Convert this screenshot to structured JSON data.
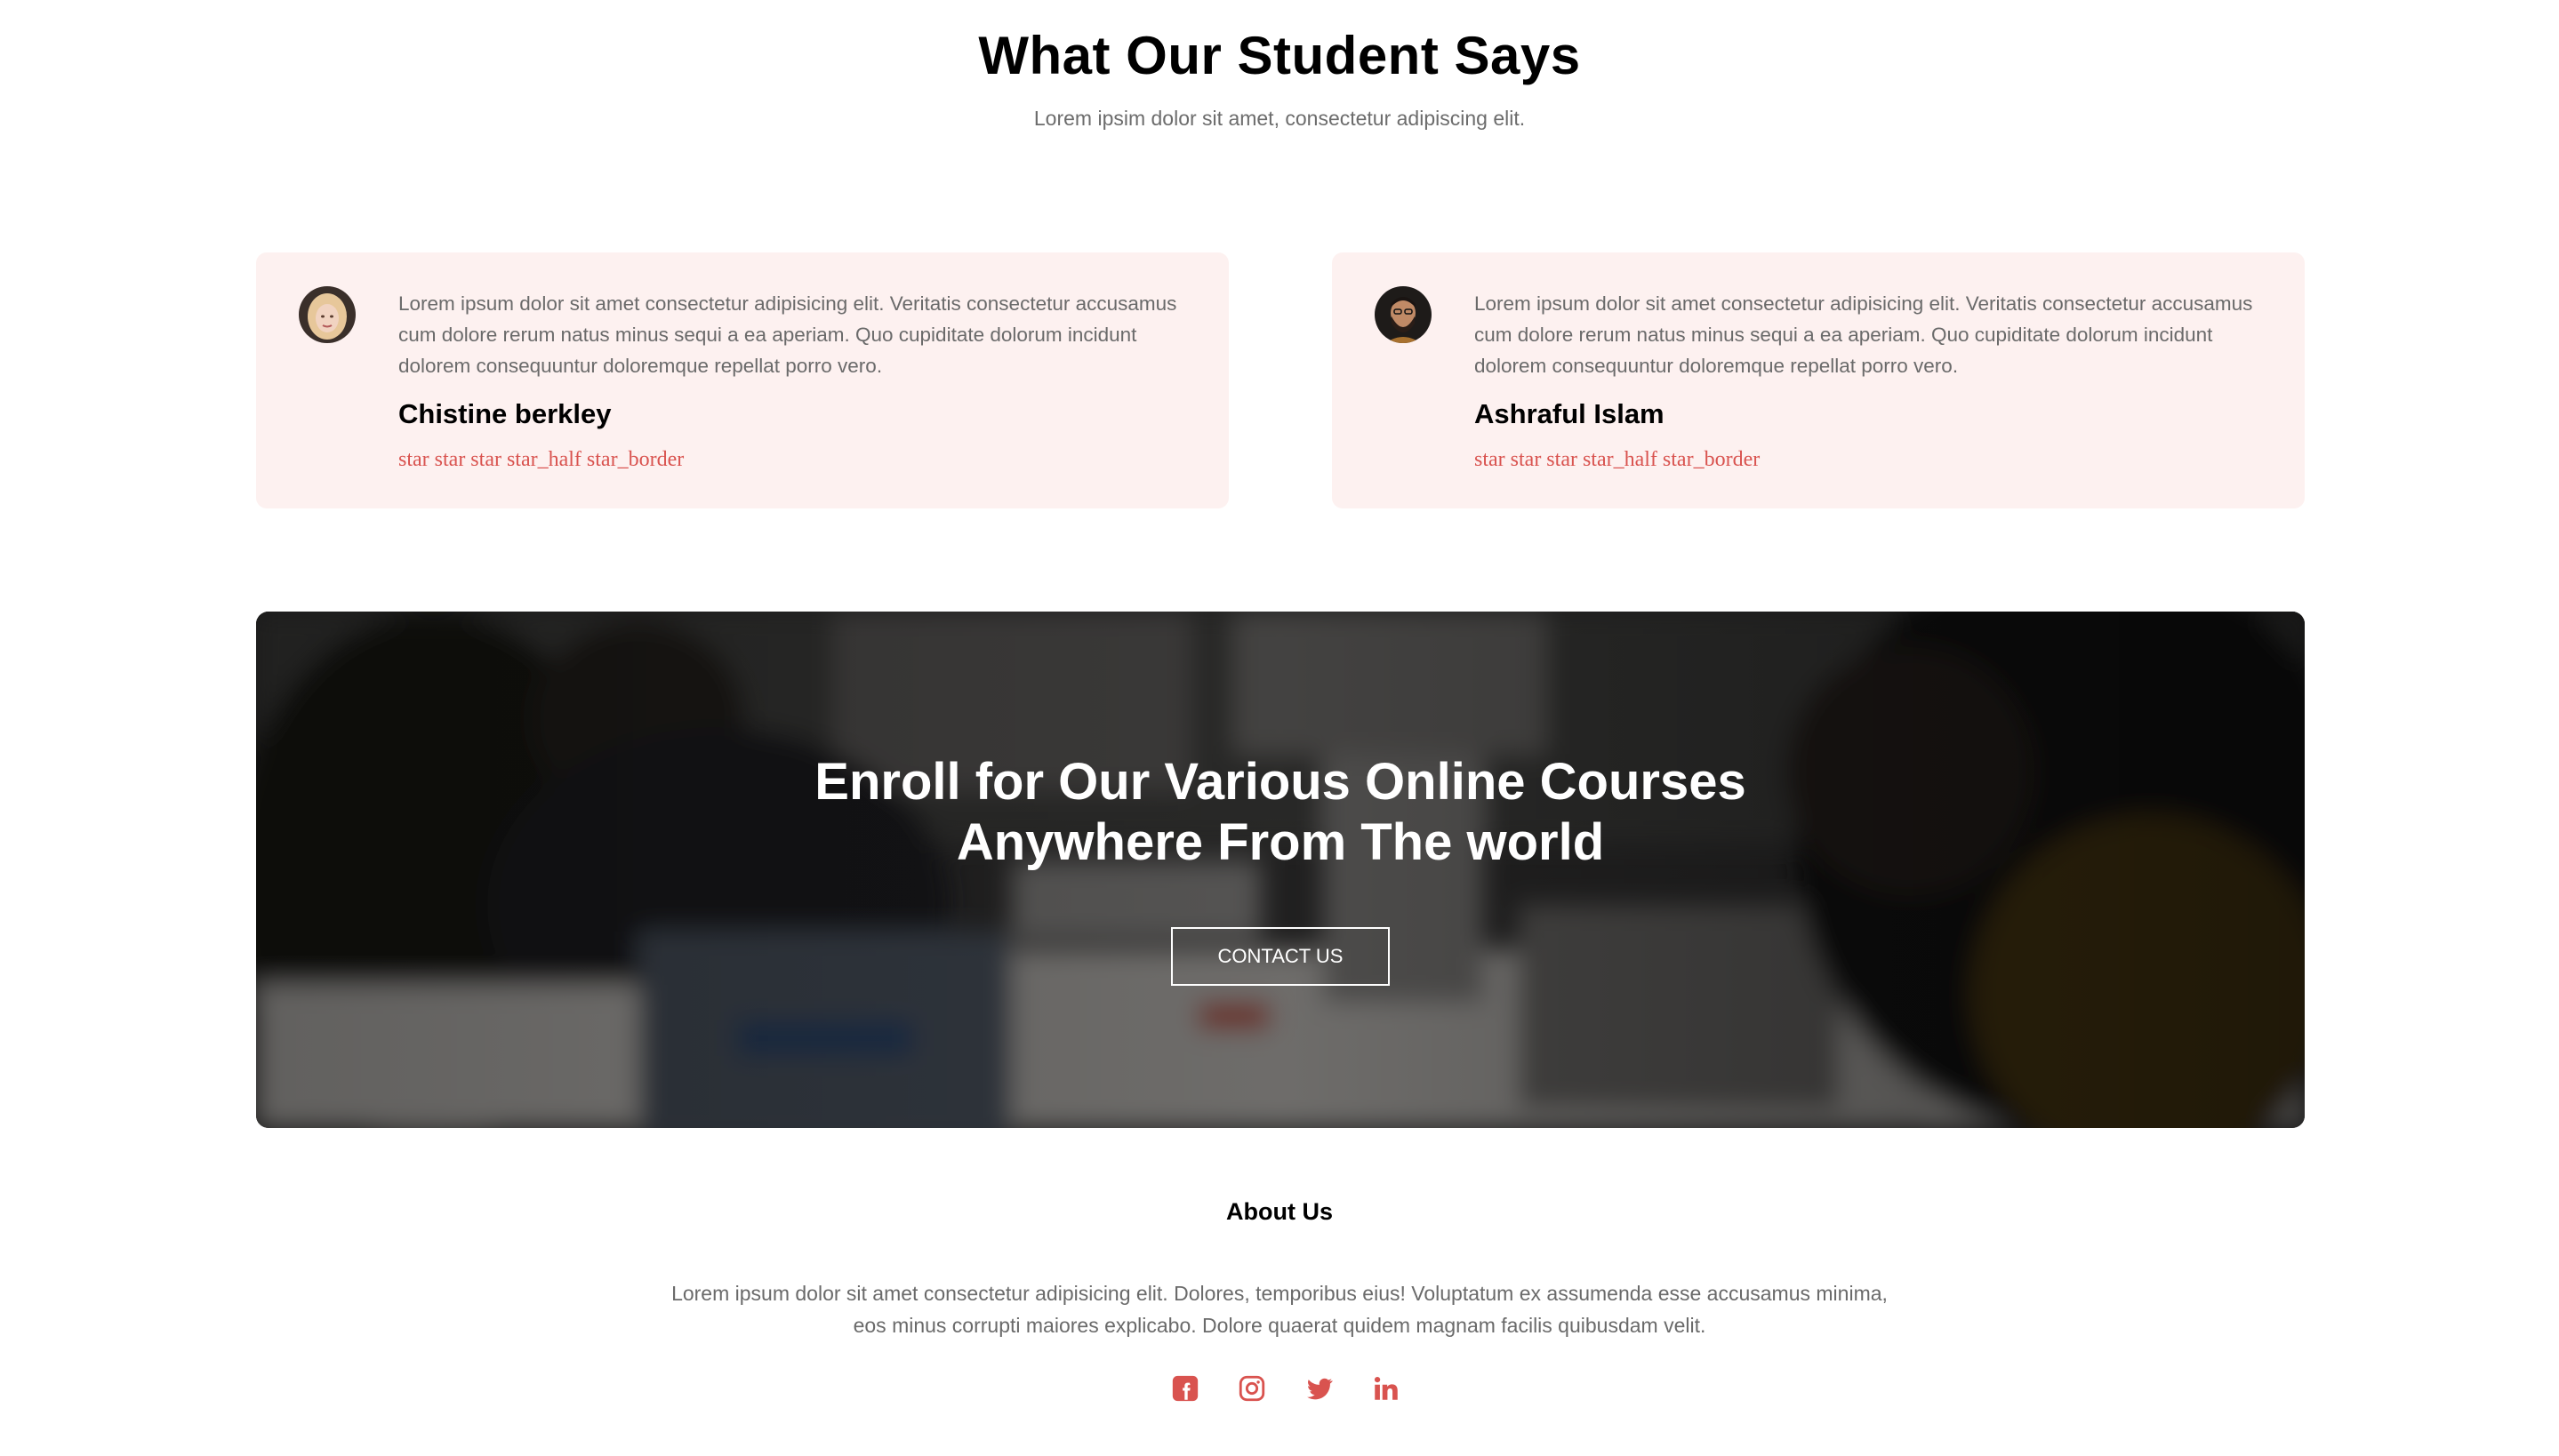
{
  "testimonials": {
    "title": "What Our Student Says",
    "subtitle": "Lorem ipsim dolor sit amet, consectetur adipiscing elit.",
    "items": [
      {
        "text": "Lorem ipsum dolor sit amet consectetur adipisicing elit. Veritatis consectetur accusamus cum dolore rerum natus minus sequi a ea aperiam. Quo cupiditate dolorum incidunt dolorem consequuntur doloremque repellat porro vero.",
        "name": "Chistine berkley",
        "stars": "star star star star_half star_border",
        "rating": 3.5
      },
      {
        "text": "Lorem ipsum dolor sit amet consectetur adipisicing elit. Veritatis consectetur accusamus cum dolore rerum natus minus sequi a ea aperiam. Quo cupiditate dolorum incidunt dolorem consequuntur doloremque repellat porro vero.",
        "name": "Ashraful Islam",
        "stars": "star star star star_half star_border",
        "rating": 3.5
      }
    ]
  },
  "banner": {
    "title_line1": "Enroll for Our Various Online Courses",
    "title_line2": "Anywhere From The world",
    "button_label": "CONTACT US"
  },
  "about": {
    "title": "About Us",
    "text_line1": "Lorem ipsum dolor sit amet consectetur adipisicing elit. Dolores, temporibus eius! Voluptatum ex assumenda esse accusamus minima,",
    "text_line2": "eos minus corrupti maiores explicabo. Dolore quaerat quidem magnam facilis quibusdam velit."
  },
  "social": [
    "facebook-icon",
    "instagram-icon",
    "twitter-icon",
    "linkedin-icon"
  ],
  "colors": {
    "accent": "#d9534f",
    "card_bg": "#fdf1f0",
    "muted_text": "#6a6a6a"
  }
}
